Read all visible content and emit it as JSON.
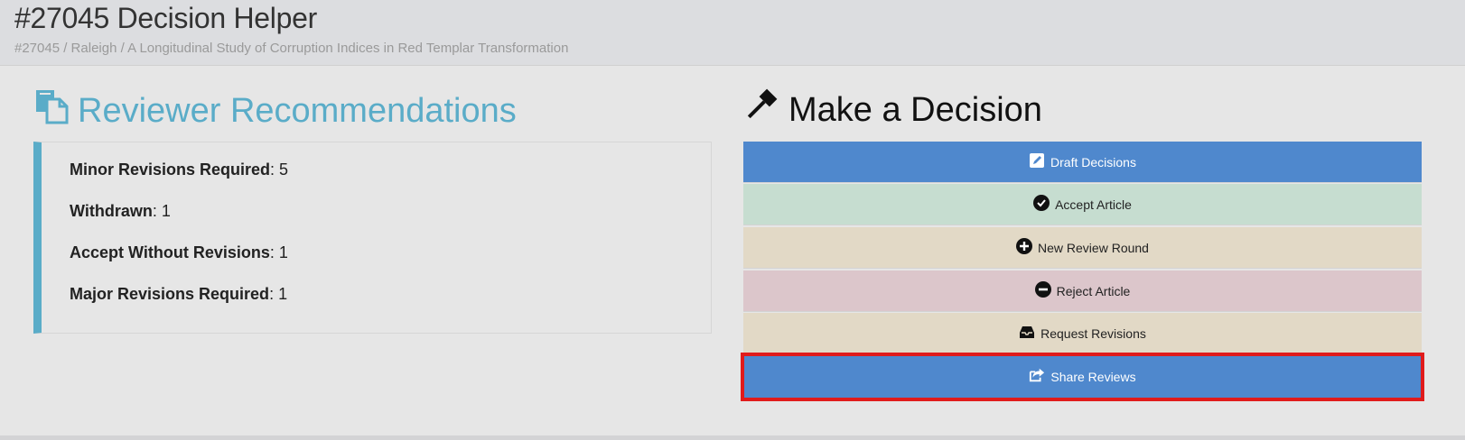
{
  "header": {
    "title": "#27045 Decision Helper",
    "breadcrumb": "#27045 / Raleigh / A Longitudinal Study of Corruption Indices in Red Templar Transformation"
  },
  "recommendations": {
    "heading": "Reviewer Recommendations",
    "icon": "copy-icon",
    "items": [
      {
        "label": "Minor Revisions Required",
        "value": ": 5"
      },
      {
        "label": "Withdrawn",
        "value": ": 1"
      },
      {
        "label": "Accept Without Revisions",
        "value": ": 1"
      },
      {
        "label": "Major Revisions Required",
        "value": ": 1"
      }
    ]
  },
  "decision": {
    "heading": "Make a Decision",
    "icon": "gavel-icon",
    "buttons": [
      {
        "label": "Draft Decisions",
        "icon": "edit-icon",
        "color": "#4f88cd"
      },
      {
        "label": "Accept Article",
        "icon": "check-circle-icon",
        "color": "#c6ddd0"
      },
      {
        "label": "New Review Round",
        "icon": "plus-circle-icon",
        "color": "#e2d9c6"
      },
      {
        "label": "Reject Article",
        "icon": "minus-circle-icon",
        "color": "#dcc6cb"
      },
      {
        "label": "Request Revisions",
        "icon": "inbox-icon",
        "color": "#e2d9c6"
      },
      {
        "label": "Share Reviews",
        "icon": "share-icon",
        "color": "#4f88cd"
      }
    ]
  },
  "colors": {
    "accent": "#5aacc8",
    "primary": "#4f88cd",
    "highlight": "#e01b1b"
  }
}
